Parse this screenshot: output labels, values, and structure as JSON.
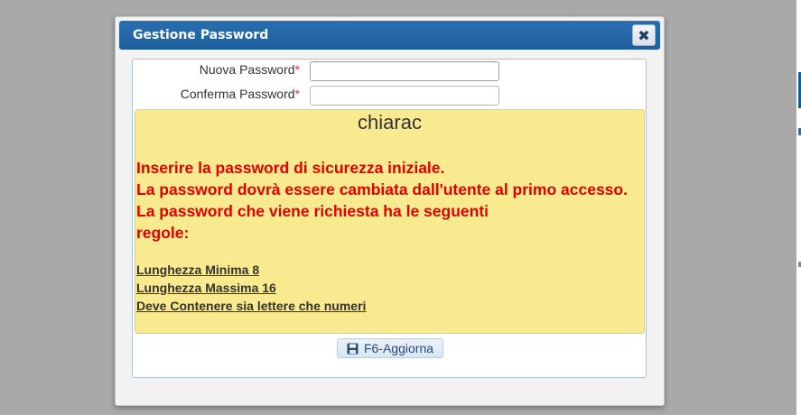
{
  "dialog": {
    "title": "Gestione Password",
    "close_icon": "close-icon",
    "close_glyph": "✖"
  },
  "form": {
    "new_password": {
      "label": "Nuova Password",
      "required_mark": "*",
      "value": ""
    },
    "confirm_password": {
      "label": "Conferma Password",
      "required_mark": "*",
      "value": ""
    }
  },
  "info": {
    "username": "chiarac",
    "messages": [
      "Inserire la password di sicurezza iniziale.",
      "La password dovrà essere cambiata dall'utente al primo accesso.",
      "La password che viene richiesta ha le seguenti",
      "regole:"
    ],
    "rules": [
      "Lunghezza Minima 8",
      "Lunghezza Massima 16",
      "Deve Contenere sia lettere che numeri"
    ]
  },
  "actions": {
    "update_label": "F6-Aggiorna",
    "update_icon": "save-icon"
  },
  "colors": {
    "titlebar": "#1d5f9e",
    "info_background": "#f9e98f",
    "message_text": "#e00000",
    "required_mark": "#d23a3a"
  }
}
